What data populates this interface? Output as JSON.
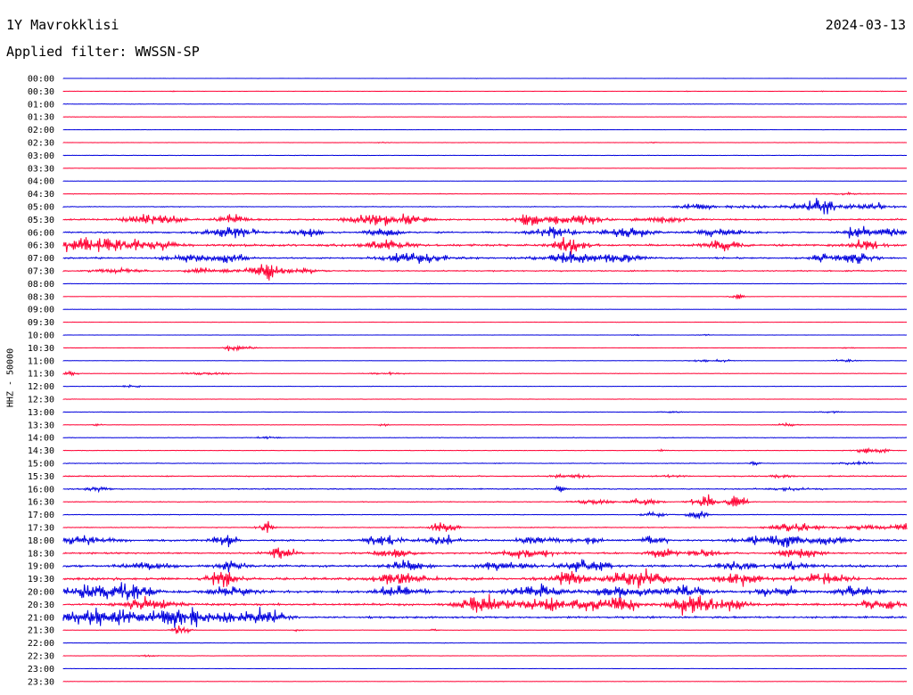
{
  "header": {
    "station": "1Y Mavrokklisi",
    "date": "2024-03-13",
    "filter": "Applied filter: WWSSN-SP"
  },
  "chart_data": {
    "type": "line",
    "ylabel": "HHZ - 50000",
    "colors": [
      "#0000dd",
      "#ff0033"
    ],
    "rows": [
      {
        "time": "00:00",
        "base": 0.3,
        "bursts": [
          [
            0.49,
            0.3,
            0.003
          ]
        ]
      },
      {
        "time": "00:30",
        "base": 0.4,
        "bursts": [
          [
            0.13,
            0.9,
            0.002
          ],
          [
            0.74,
            0.8,
            0.002
          ],
          [
            0.9,
            0.6,
            0.002
          ],
          [
            0.97,
            0.6,
            0.002
          ]
        ]
      },
      {
        "time": "01:00",
        "base": 0.9,
        "bursts": []
      },
      {
        "time": "01:30",
        "base": 0.9,
        "bursts": []
      },
      {
        "time": "02:00",
        "base": 0.5,
        "bursts": []
      },
      {
        "time": "02:30",
        "base": 0.7,
        "bursts": [
          [
            0.38,
            0.8,
            0.005
          ],
          [
            0.7,
            0.7,
            0.004
          ]
        ]
      },
      {
        "time": "03:00",
        "base": 0.9,
        "bursts": []
      },
      {
        "time": "03:30",
        "base": 0.5,
        "bursts": []
      },
      {
        "time": "04:00",
        "base": 0.6,
        "bursts": []
      },
      {
        "time": "04:30",
        "base": 1.2,
        "bursts": [
          [
            0.93,
            1.5,
            0.02
          ]
        ]
      },
      {
        "time": "05:00",
        "base": 1.4,
        "bursts": [
          [
            0.75,
            5,
            0.015
          ],
          [
            0.81,
            2.5,
            0.02
          ],
          [
            0.88,
            5,
            0.02
          ],
          [
            0.9,
            10,
            0.01
          ],
          [
            0.94,
            4,
            0.02
          ],
          [
            0.97,
            5,
            0.01
          ]
        ]
      },
      {
        "time": "05:30",
        "base": 3,
        "bursts": [
          [
            0.09,
            7,
            0.012
          ],
          [
            0.12,
            6,
            0.015
          ],
          [
            0.2,
            9,
            0.012
          ],
          [
            0.36,
            8,
            0.015
          ],
          [
            0.4,
            8,
            0.02
          ],
          [
            0.55,
            8,
            0.01
          ],
          [
            0.58,
            5,
            0.02
          ],
          [
            0.62,
            6,
            0.015
          ],
          [
            0.71,
            4,
            0.02
          ]
        ]
      },
      {
        "time": "06:00",
        "base": 3,
        "bursts": [
          [
            0.2,
            8,
            0.02
          ],
          [
            0.29,
            7,
            0.012
          ],
          [
            0.38,
            7,
            0.015
          ],
          [
            0.58,
            10,
            0.015
          ],
          [
            0.67,
            7,
            0.02
          ],
          [
            0.78,
            6,
            0.02
          ],
          [
            0.94,
            10,
            0.012
          ],
          [
            0.98,
            9,
            0.01
          ]
        ]
      },
      {
        "time": "06:30",
        "base": 4,
        "bursts": [
          [
            0.02,
            10,
            0.02
          ],
          [
            0.07,
            9,
            0.02
          ],
          [
            0.12,
            6,
            0.015
          ],
          [
            0.38,
            7,
            0.02
          ],
          [
            0.6,
            14,
            0.012
          ],
          [
            0.78,
            9,
            0.015
          ],
          [
            0.95,
            10,
            0.012
          ]
        ]
      },
      {
        "time": "07:00",
        "base": 3,
        "bursts": [
          [
            0.15,
            6,
            0.02
          ],
          [
            0.2,
            7,
            0.012
          ],
          [
            0.42,
            10,
            0.025
          ],
          [
            0.6,
            10,
            0.02
          ],
          [
            0.66,
            6,
            0.02
          ],
          [
            0.9,
            6,
            0.01
          ],
          [
            0.94,
            8,
            0.015
          ]
        ]
      },
      {
        "time": "07:30",
        "base": 2.2,
        "bursts": [
          [
            0.06,
            3,
            0.02
          ],
          [
            0.17,
            4,
            0.02
          ],
          [
            0.24,
            14,
            0.012
          ],
          [
            0.28,
            4,
            0.02
          ]
        ]
      },
      {
        "time": "08:00",
        "base": 1,
        "bursts": []
      },
      {
        "time": "08:30",
        "base": 0.5,
        "bursts": [
          [
            0.8,
            4,
            0.006
          ]
        ]
      },
      {
        "time": "09:00",
        "base": 0.6,
        "bursts": []
      },
      {
        "time": "09:30",
        "base": 0.6,
        "bursts": []
      },
      {
        "time": "10:00",
        "base": 0.5,
        "bursts": [
          [
            0.68,
            1.2,
            0.005
          ],
          [
            0.76,
            1.2,
            0.005
          ]
        ]
      },
      {
        "time": "10:30",
        "base": 0.6,
        "bursts": [
          [
            0.2,
            6,
            0.006
          ],
          [
            0.22,
            2,
            0.01
          ],
          [
            0.93,
            1.4,
            0.005
          ]
        ]
      },
      {
        "time": "11:00",
        "base": 0.6,
        "bursts": [
          [
            0.77,
            2,
            0.02
          ],
          [
            0.93,
            3,
            0.01
          ]
        ]
      },
      {
        "time": "11:30",
        "base": 0.9,
        "bursts": [
          [
            0.01,
            4,
            0.005
          ],
          [
            0.17,
            2,
            0.02
          ],
          [
            0.38,
            2,
            0.015
          ]
        ]
      },
      {
        "time": "12:00",
        "base": 0.8,
        "bursts": [
          [
            0.08,
            1.5,
            0.01
          ]
        ]
      },
      {
        "time": "12:30",
        "base": 0.8,
        "bursts": []
      },
      {
        "time": "13:00",
        "base": 0.9,
        "bursts": [
          [
            0.72,
            1.5,
            0.01
          ],
          [
            0.91,
            1.5,
            0.01
          ]
        ]
      },
      {
        "time": "13:30",
        "base": 1,
        "bursts": [
          [
            0.04,
            2,
            0.003
          ],
          [
            0.38,
            3,
            0.004
          ],
          [
            0.86,
            2,
            0.01
          ]
        ]
      },
      {
        "time": "14:00",
        "base": 1.2,
        "bursts": [
          [
            0.24,
            1.5,
            0.01
          ]
        ]
      },
      {
        "time": "14:30",
        "base": 1,
        "bursts": [
          [
            0.71,
            3,
            0.003
          ],
          [
            0.96,
            7,
            0.012
          ]
        ]
      },
      {
        "time": "15:00",
        "base": 1.4,
        "bursts": [
          [
            0.82,
            5,
            0.004
          ],
          [
            0.94,
            2,
            0.015
          ]
        ]
      },
      {
        "time": "15:30",
        "base": 2,
        "bursts": [
          [
            0.6,
            3,
            0.015
          ],
          [
            0.72,
            2,
            0.01
          ],
          [
            0.85,
            3,
            0.01
          ]
        ]
      },
      {
        "time": "16:00",
        "base": 2,
        "bursts": [
          [
            0.04,
            3,
            0.01
          ],
          [
            0.59,
            5,
            0.005
          ],
          [
            0.86,
            2,
            0.02
          ]
        ]
      },
      {
        "time": "16:30",
        "base": 1.4,
        "bursts": [
          [
            0.63,
            4,
            0.015
          ],
          [
            0.69,
            6,
            0.012
          ],
          [
            0.76,
            11,
            0.01
          ],
          [
            0.8,
            14,
            0.008
          ]
        ]
      },
      {
        "time": "17:00",
        "base": 1.3,
        "bursts": [
          [
            0.75,
            8,
            0.008
          ],
          [
            0.7,
            4,
            0.01
          ]
        ]
      },
      {
        "time": "17:30",
        "base": 1.6,
        "bursts": [
          [
            0.24,
            12,
            0.006
          ],
          [
            0.45,
            6,
            0.012
          ],
          [
            0.87,
            7,
            0.02
          ],
          [
            0.95,
            4,
            0.02
          ],
          [
            1,
            6,
            0.01
          ]
        ]
      },
      {
        "time": "18:00",
        "base": 3.5,
        "bursts": [
          [
            0.03,
            7,
            0.02
          ],
          [
            0.19,
            11,
            0.01
          ],
          [
            0.38,
            9,
            0.015
          ],
          [
            0.45,
            8,
            0.012
          ],
          [
            0.56,
            6,
            0.015
          ],
          [
            0.62,
            7,
            0.01
          ],
          [
            0.7,
            7,
            0.01
          ],
          [
            0.82,
            6,
            0.015
          ],
          [
            0.86,
            9,
            0.012
          ],
          [
            0.91,
            7,
            0.015
          ]
        ]
      },
      {
        "time": "18:30",
        "base": 3,
        "bursts": [
          [
            0.26,
            9,
            0.012
          ],
          [
            0.39,
            7,
            0.015
          ],
          [
            0.55,
            8,
            0.02
          ],
          [
            0.71,
            7,
            0.012
          ],
          [
            0.76,
            6,
            0.015
          ],
          [
            0.87,
            9,
            0.015
          ]
        ]
      },
      {
        "time": "19:00",
        "base": 4,
        "bursts": [
          [
            0.1,
            6,
            0.02
          ],
          [
            0.2,
            11,
            0.01
          ],
          [
            0.41,
            9,
            0.015
          ],
          [
            0.52,
            8,
            0.02
          ],
          [
            0.62,
            9,
            0.02
          ],
          [
            0.8,
            7,
            0.015
          ],
          [
            0.86,
            7,
            0.015
          ]
        ]
      },
      {
        "time": "19:30",
        "base": 4.5,
        "bursts": [
          [
            0.19,
            14,
            0.01
          ],
          [
            0.4,
            10,
            0.02
          ],
          [
            0.6,
            12,
            0.015
          ],
          [
            0.67,
            14,
            0.015
          ],
          [
            0.7,
            10,
            0.015
          ],
          [
            0.8,
            10,
            0.02
          ],
          [
            0.9,
            8,
            0.02
          ]
        ]
      },
      {
        "time": "20:00",
        "base": 4.5,
        "bursts": [
          [
            0.03,
            10,
            0.02
          ],
          [
            0.08,
            12,
            0.02
          ],
          [
            0.2,
            8,
            0.02
          ],
          [
            0.4,
            9,
            0.02
          ],
          [
            0.56,
            9,
            0.02
          ],
          [
            0.66,
            10,
            0.02
          ],
          [
            0.74,
            8,
            0.02
          ],
          [
            0.85,
            9,
            0.015
          ],
          [
            0.94,
            8,
            0.015
          ]
        ]
      },
      {
        "time": "20:30",
        "base": 4,
        "bursts": [
          [
            0.1,
            9,
            0.02
          ],
          [
            0.5,
            13,
            0.02
          ],
          [
            0.57,
            11,
            0.02
          ],
          [
            0.62,
            12,
            0.015
          ],
          [
            0.66,
            13,
            0.015
          ],
          [
            0.74,
            12,
            0.015
          ],
          [
            0.78,
            10,
            0.02
          ],
          [
            0.97,
            10,
            0.015
          ]
        ]
      },
      {
        "time": "21:00",
        "base": 3.5,
        "bursts": [
          [
            0.01,
            9,
            0.02
          ],
          [
            0.04,
            10,
            0.02
          ],
          [
            0.07,
            8,
            0.015
          ],
          [
            0.12,
            11,
            0.02
          ],
          [
            0.15,
            14,
            0.015
          ],
          [
            0.2,
            9,
            0.02
          ],
          [
            0.24,
            12,
            0.015
          ]
        ]
      },
      {
        "time": "21:30",
        "base": 0.8,
        "bursts": [
          [
            0.14,
            12,
            0.006
          ],
          [
            0.28,
            2,
            0.004
          ],
          [
            0.44,
            3,
            0.003
          ]
        ]
      },
      {
        "time": "22:00",
        "base": 0.9,
        "bursts": []
      },
      {
        "time": "22:30",
        "base": 0.8,
        "bursts": [
          [
            0.1,
            1.5,
            0.008
          ]
        ]
      },
      {
        "time": "23:00",
        "base": 0.5,
        "bursts": []
      },
      {
        "time": "23:30",
        "base": 0.8,
        "bursts": []
      }
    ]
  }
}
